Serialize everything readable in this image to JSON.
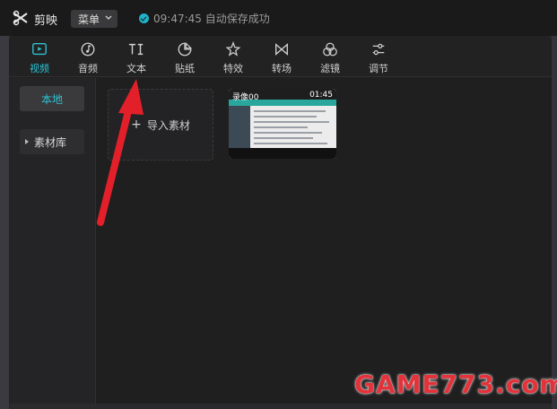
{
  "titlebar": {
    "app_name": "剪映",
    "menu_label": "菜单",
    "save_status": "09:47:45 自动保存成功"
  },
  "toolbar": {
    "items": [
      {
        "label": "视频",
        "icon": "video-icon",
        "active": true
      },
      {
        "label": "音频",
        "icon": "audio-icon",
        "active": false
      },
      {
        "label": "文本",
        "icon": "text-icon",
        "active": false
      },
      {
        "label": "贴纸",
        "icon": "sticker-icon",
        "active": false
      },
      {
        "label": "特效",
        "icon": "effects-icon",
        "active": false
      },
      {
        "label": "转场",
        "icon": "transition-icon",
        "active": false
      },
      {
        "label": "滤镜",
        "icon": "filter-icon",
        "active": false
      },
      {
        "label": "调节",
        "icon": "adjust-icon",
        "active": false
      }
    ]
  },
  "sidebar": {
    "local_label": "本地",
    "library_label": "素材库"
  },
  "media": {
    "import_label": "导入素材",
    "clip": {
      "name": "录像00",
      "duration": "01:45"
    }
  },
  "watermark": "GAME773.com",
  "colors": {
    "accent": "#2dc3d2",
    "arrow": "#e3202a"
  }
}
